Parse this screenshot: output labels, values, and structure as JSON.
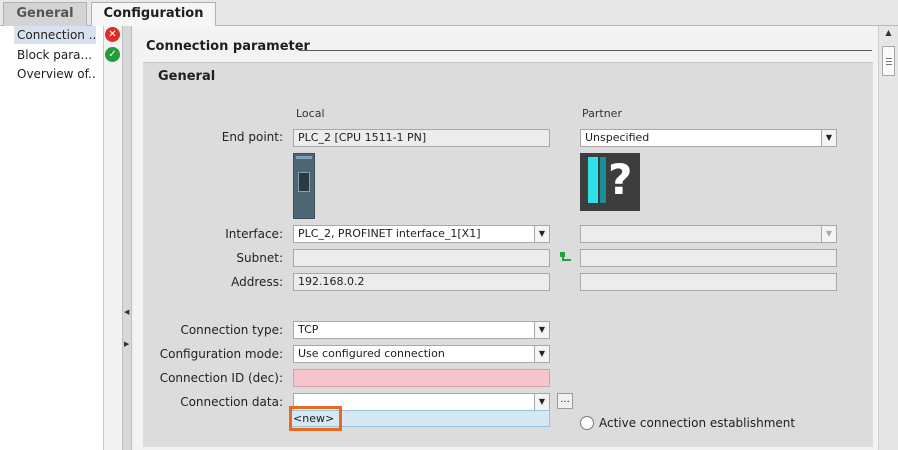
{
  "tabs": {
    "general": "General",
    "configuration": "Configuration"
  },
  "nav": {
    "items": [
      "Connection ...",
      "Block para...",
      "Overview of..."
    ]
  },
  "section": {
    "title": "Connection parameter",
    "group_title": "General"
  },
  "columns": {
    "local": "Local",
    "partner": "Partner"
  },
  "labels": {
    "end_point": "End point:",
    "interface": "Interface:",
    "subnet": "Subnet:",
    "address": "Address:",
    "connection_type": "Connection type:",
    "configuration_mode": "Configuration mode:",
    "connection_id": "Connection ID (dec):",
    "connection_data": "Connection data:"
  },
  "local": {
    "end_point": "PLC_2 [CPU 1511-1 PN]",
    "interface": "PLC_2, PROFINET interface_1[X1]",
    "subnet": "",
    "address": "192.168.0.2",
    "connection_type": "TCP",
    "configuration_mode": "Use configured connection",
    "connection_id": "",
    "connection_data": ""
  },
  "partner": {
    "end_point": "Unspecified",
    "interface": "",
    "subnet": "",
    "address": ""
  },
  "popup": {
    "new_item": "<new>"
  },
  "buttons": {
    "browse": "..."
  },
  "radio": {
    "active_connection": "Active connection establishment"
  },
  "colors": {
    "highlight": "#e8681d",
    "error": "#d9302c",
    "ok": "#1f9e3a",
    "pink_field": "#f7c6cc"
  },
  "icons": {
    "error": "error-x-icon",
    "ok": "check-icon",
    "subnet": "subnet-connector-icon"
  }
}
